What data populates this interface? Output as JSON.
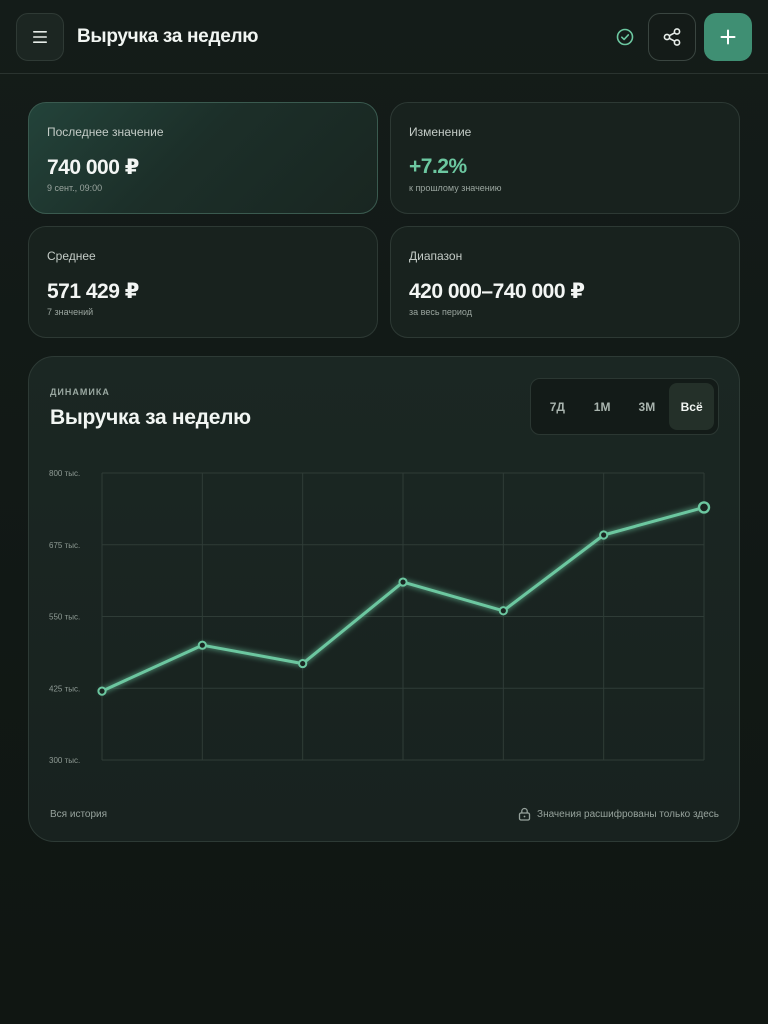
{
  "header": {
    "title": "Выручка за неделю",
    "icons": {
      "menu": "hamburger-icon",
      "status": "check-circle-icon",
      "share": "share-icon",
      "add": "plus-icon"
    }
  },
  "stats": [
    {
      "label": "Последнее значение",
      "value": "740 000 ₽",
      "sub": "9 сент., 09:00"
    },
    {
      "label": "Изменение",
      "value": "+7.2%",
      "sub": "к прошлому значению"
    },
    {
      "label": "Среднее",
      "value": "571 429 ₽",
      "sub": "7 значений"
    },
    {
      "label": "Диапазон",
      "value": "420 000–740 000 ₽",
      "sub": "за весь период"
    }
  ],
  "panel": {
    "eyebrow": "ДИНАМИКА",
    "title": "Выручка за неделю",
    "tabs": [
      "7Д",
      "1М",
      "3М",
      "Всё"
    ],
    "active_tab": "Всё",
    "footer_left": "Вся история",
    "footer_right": "Значения расшифрованы только здесь"
  },
  "colors": {
    "accent": "#3f8f73",
    "line": "#6cc7a0",
    "positive": "#6cc7a0"
  },
  "chart_data": {
    "type": "line",
    "x": [
      1,
      2,
      3,
      4,
      5,
      6,
      7
    ],
    "series": [
      {
        "values": [
          420000,
          500000,
          468000,
          610000,
          560000,
          692000,
          740000
        ]
      }
    ],
    "yticks": [
      "800 тыс.",
      "675 тыс.",
      "550 тыс.",
      "425 тыс.",
      "300 тыс."
    ],
    "ylim": [
      300000,
      800000
    ],
    "grid": true
  }
}
